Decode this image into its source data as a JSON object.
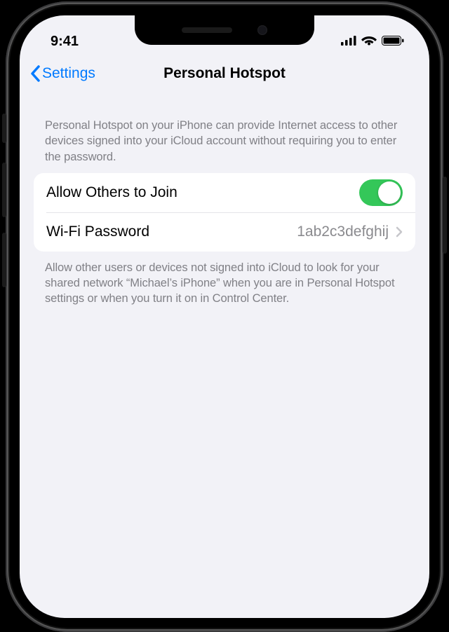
{
  "status": {
    "time": "9:41"
  },
  "nav": {
    "back_label": "Settings",
    "title": "Personal Hotspot"
  },
  "header_desc": "Personal Hotspot on your iPhone can provide Internet access to other devices signed into your iCloud account without requiring you to enter the password.",
  "rows": {
    "allow": {
      "label": "Allow Others to Join",
      "enabled": true
    },
    "wifi": {
      "label": "Wi-Fi Password",
      "value": "1ab2c3defghij"
    }
  },
  "footer_desc": "Allow other users or devices not signed into iCloud to look for your shared network “Michael’s iPhone” when you are in Personal Hotspot settings or when you turn it on in Control Center.",
  "colors": {
    "accent": "#007aff",
    "toggle_on": "#34c759",
    "bg": "#f2f2f7"
  }
}
